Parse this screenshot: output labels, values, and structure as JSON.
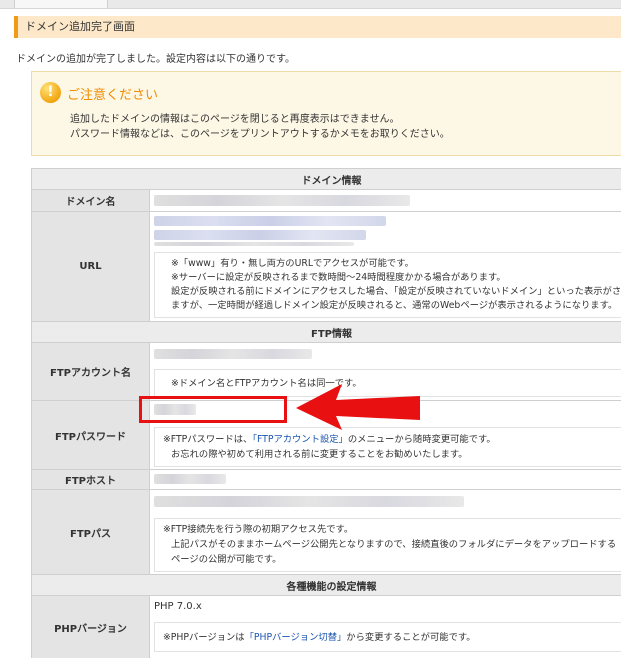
{
  "page_title": "ドメイン追加完了画面",
  "intro": "ドメインの追加が完了しました。設定内容は以下の通りです。",
  "notice": {
    "title": "ご注意ください",
    "line1": "追加したドメインの情報はこのページを閉じると再度表示はできません。",
    "line2": "パスワード情報などは、このページをプリントアウトするかメモをお取りください。"
  },
  "domain_info": {
    "heading": "ドメイン情報",
    "domain_label": "ドメイン名",
    "url_label": "URL",
    "url_notes": [
      "※「www」有り・無し両方のURLでアクセスが可能です。",
      "※サーバーに設定が反映されるまで数時間～24時間程度かかる場合があります。",
      "設定が反映される前にドメインにアクセスした場合、「設定が反映されていないドメイン」といった表示がされ",
      "ますが、一定時間が経過しドメイン設定が反映されると、通常のWebページが表示されるようになります。"
    ]
  },
  "ftp_info": {
    "heading": "FTP情報",
    "account_label": "FTPアカウント名",
    "account_note": "※ドメイン名とFTPアカウント名は同一です。",
    "password_label": "FTPパスワード",
    "password_note_pre": "※FTPパスワードは、",
    "password_note_link": "「FTPアカウント設定」",
    "password_note_post": "のメニューから随時変更可能です。",
    "password_note2": "お忘れの際や初めて利用される前に変更することをお勧めいたします。",
    "host_label": "FTPホスト",
    "path_label": "FTPパス",
    "path_notes": [
      "※FTP接続先を行う際の初期アクセス先です。",
      "上記パスがそのままホームページ公開先となりますので、接続直後のフォルダにデータをアップロードする",
      "ページの公開が可能です。"
    ]
  },
  "features": {
    "heading": "各種機能の設定情報",
    "php_label": "PHPバージョン",
    "php_value": "PHP 7.0.x",
    "php_note_pre": "※PHPバージョンは",
    "php_note_link": "「PHPバージョン切替」",
    "php_note_post": "から変更することが可能です。"
  },
  "colors": {
    "accent": "#f29a17",
    "title_bg": "#fde9c9",
    "notice_title": "#f08c00",
    "annotation": "#e81010",
    "link": "#1a55b0"
  }
}
